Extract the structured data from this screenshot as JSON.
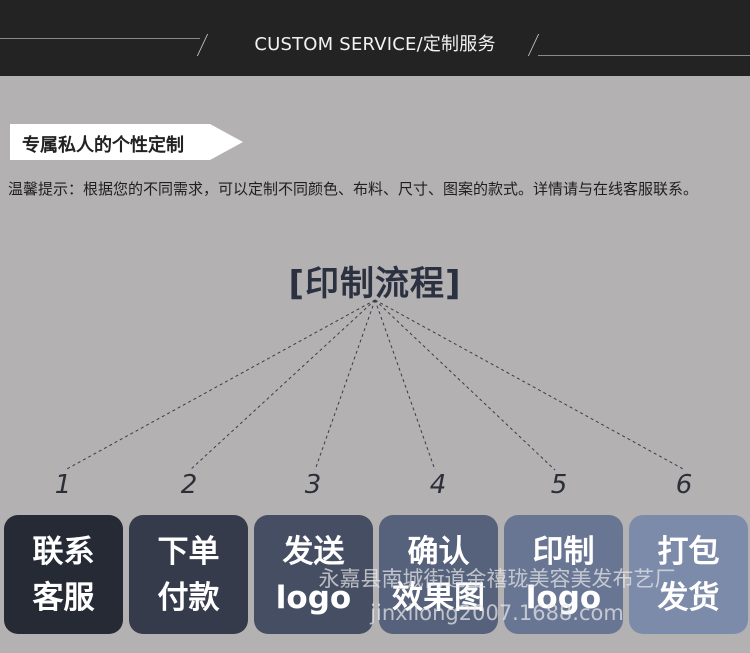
{
  "header": {
    "title": "CUSTOM SERVICE/定制服务"
  },
  "tag": {
    "label": "专属私人的个性定制"
  },
  "tip": {
    "text": "温馨提示：根据您的不同需求，可以定制不同颜色、布料、尺寸、图案的款式。详情请与在线客服联系。"
  },
  "flow": {
    "title": "[印制流程]",
    "steps": [
      {
        "number": "1",
        "label": "联系\n客服",
        "color": "#262a35"
      },
      {
        "number": "2",
        "label": "下单\n付款",
        "color": "#353b4b"
      },
      {
        "number": "3",
        "label": "发送\nlogo",
        "color": "#464e63"
      },
      {
        "number": "4",
        "label": "确认\n效果图",
        "color": "#56617b"
      },
      {
        "number": "5",
        "label": "印制\nlogo",
        "color": "#687593"
      },
      {
        "number": "6",
        "label": "打包\n发货",
        "color": "#7d8bab"
      }
    ]
  },
  "watermark": {
    "line1": "永嘉县南城街道金禧珑美容美发布艺厂",
    "line2": "jinxilong2007.1688.com"
  }
}
